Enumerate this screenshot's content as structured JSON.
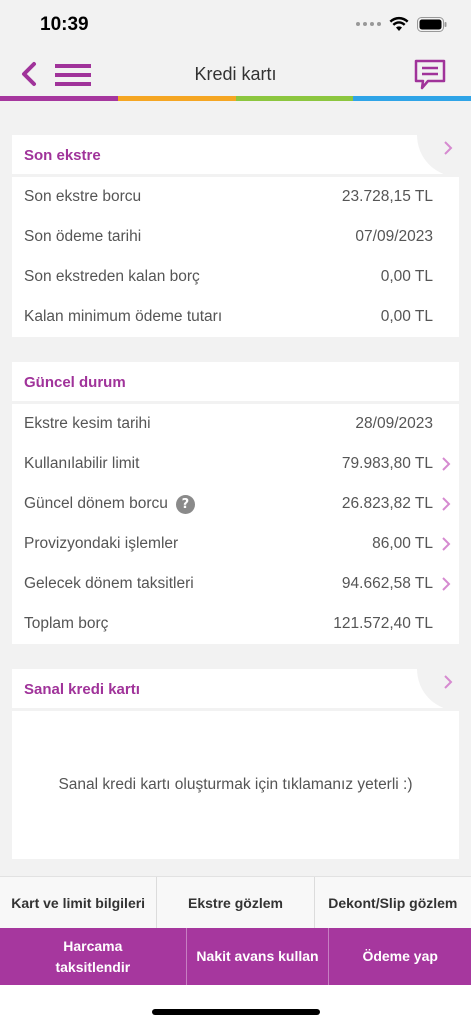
{
  "status_bar": {
    "time": "10:39"
  },
  "nav": {
    "title": "Kredi kartı"
  },
  "colors": {
    "accent": "#a0339a",
    "rainbow": [
      "#a6379e",
      "#f5a623",
      "#8cc63f",
      "#2fa4e7"
    ]
  },
  "son_ekstre": {
    "title": "Son ekstre",
    "rows": [
      {
        "label": "Son ekstre borcu",
        "value": "23.728,15 TL"
      },
      {
        "label": "Son ödeme tarihi",
        "value": "07/09/2023"
      },
      {
        "label": "Son ekstreden kalan borç",
        "value": "0,00 TL"
      },
      {
        "label": "Kalan minimum ödeme tutarı",
        "value": "0,00 TL"
      }
    ]
  },
  "guncel_durum": {
    "title": "Güncel durum",
    "rows": [
      {
        "label": "Ekstre kesim tarihi",
        "value": "28/09/2023"
      },
      {
        "label": "Kullanılabilir limit",
        "value": "79.983,80 TL"
      },
      {
        "label": "Güncel dönem borcu",
        "value": "26.823,82 TL",
        "help_icon": "?"
      },
      {
        "label": "Provizyondaki işlemler",
        "value": "86,00 TL"
      },
      {
        "label": "Gelecek dönem taksitleri",
        "value": "94.662,58 TL"
      },
      {
        "label": "Toplam borç",
        "value": "121.572,40 TL"
      }
    ]
  },
  "sanal_kart": {
    "title": "Sanal kredi kartı",
    "message": "Sanal kredi kartı oluşturmak için tıklamanız yeterli :)"
  },
  "bottom_buttons": {
    "row1": [
      "Kart ve limit bilgileri",
      "Ekstre gözlem",
      "Dekont/Slip gözlem"
    ],
    "row2": [
      "Harcama taksitlendir",
      "Nakit avans kullan",
      "Ödeme yap"
    ]
  }
}
